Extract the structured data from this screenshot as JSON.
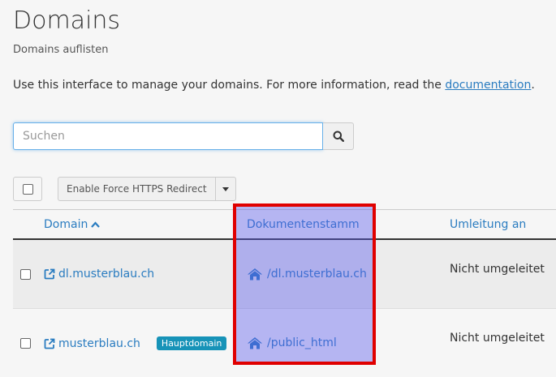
{
  "page": {
    "title": "Domains",
    "subtitle": "Domains auflisten",
    "intro_text": "Use this interface to manage your domains. For more information, read the ",
    "intro_link": "documentation",
    "intro_end": "."
  },
  "search": {
    "placeholder": "Suchen",
    "icon": "search-icon"
  },
  "toolbar": {
    "https_label": "Enable Force HTTPS Redirect",
    "caret_icon": "caret-down-icon"
  },
  "table": {
    "headers": {
      "domain": "Domain",
      "docroot": "Dokumentenstamm",
      "redirect": "Umleitung an"
    },
    "sort_icon": "chevron-up-icon",
    "rows": [
      {
        "domain": "dl.musterblau.ch",
        "badge": "",
        "docroot": "/dl.musterblau.ch",
        "redirect": "Nicht umgeleitet"
      },
      {
        "domain": "musterblau.ch",
        "badge": "Hauptdomain",
        "docroot": "/public_html",
        "redirect": "Nicht umgeleitet"
      }
    ]
  },
  "colors": {
    "link": "#2a7cc0",
    "badge": "#1793b8",
    "highlight_fill": "#5a5aeb",
    "highlight_border": "#e00000"
  }
}
